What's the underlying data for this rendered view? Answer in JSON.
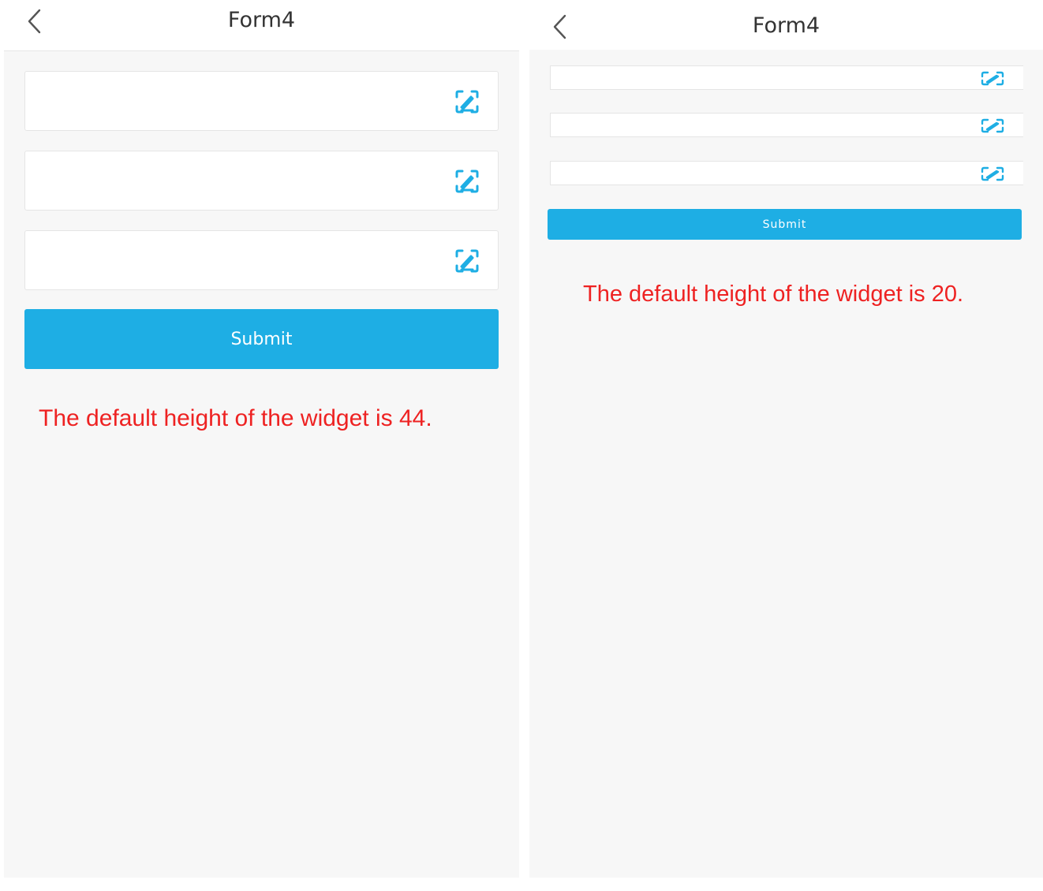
{
  "left_screen": {
    "title": "Form4",
    "back_icon": "chevron-left-icon",
    "fields": [
      {
        "value": "",
        "icon": "scan-edit-icon"
      },
      {
        "value": "",
        "icon": "scan-edit-icon"
      },
      {
        "value": "",
        "icon": "scan-edit-icon"
      }
    ],
    "submit_label": "Submit",
    "note": "The default height of the widget is 44."
  },
  "right_screen": {
    "title": "Form4",
    "back_icon": "chevron-left-icon",
    "fields": [
      {
        "value": "",
        "icon": "scan-edit-icon"
      },
      {
        "value": "",
        "icon": "scan-edit-icon"
      },
      {
        "value": "",
        "icon": "scan-edit-icon"
      }
    ],
    "submit_label": "Submit",
    "note": "The default height of the widget is 20."
  },
  "colors": {
    "accent": "#1eaee4",
    "note_text": "#ee2222",
    "background": "#f7f7f7",
    "navbar": "#ffffff"
  }
}
